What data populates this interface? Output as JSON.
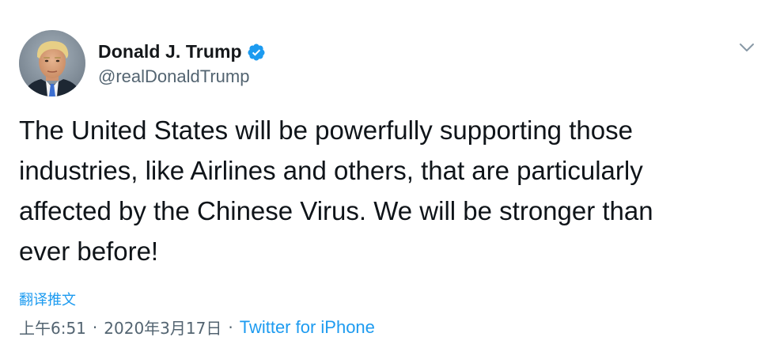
{
  "author": {
    "display_name": "Donald J. Trump",
    "handle": "@realDonaldTrump",
    "verified": true,
    "avatar_icon": "profile-photo",
    "verified_icon": "verified-badge-icon",
    "verified_color": "#1d9bf0"
  },
  "tweet": {
    "text": "The United States will be powerfully supporting those industries, like Airlines and others, that are particularly affected by the Chinese Virus. We will be stronger than ever before!",
    "lines": [
      "The United States will be powerfully supporting those",
      "industries, like Airlines and others, that are particularly",
      "affected by the Chinese Virus. We will be stronger than",
      "ever before!"
    ]
  },
  "actions": {
    "translate_label": "翻译推文",
    "menu_icon": "chevron-down-icon"
  },
  "meta": {
    "time": "上午6:51",
    "separator": "·",
    "date": "2020年3月17日",
    "source": "Twitter for iPhone"
  },
  "colors": {
    "accent": "#1d9bf0",
    "text_primary": "#0f1419",
    "text_secondary": "#536471"
  }
}
